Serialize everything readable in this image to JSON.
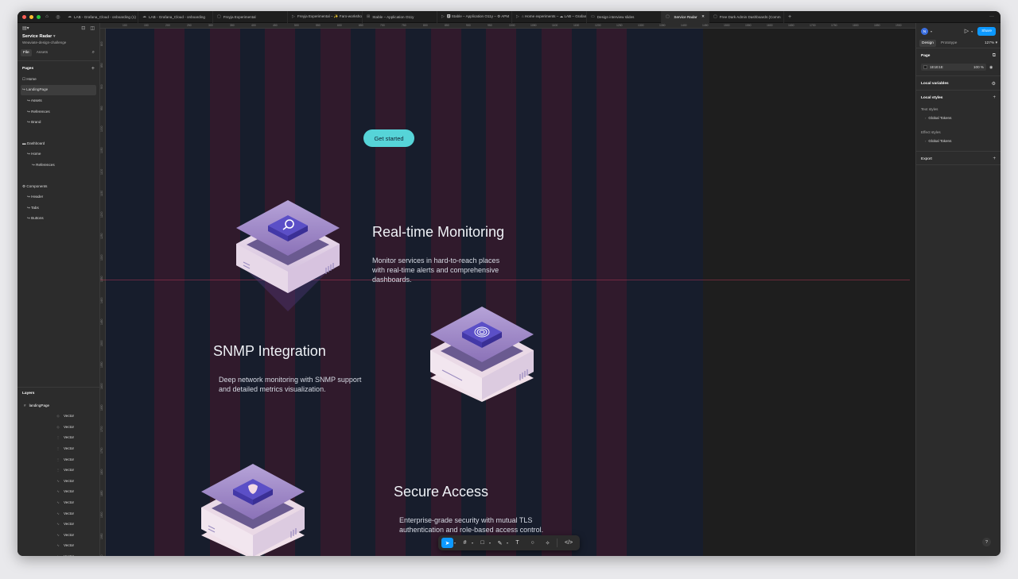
{
  "window": {
    "tabs": [
      {
        "icon": "cloud",
        "label": "LAB - Grafana_Cloud - onboarding (1)"
      },
      {
        "icon": "cloud",
        "label": "LAB - Grafana_Cloud - onboarding"
      },
      {
        "icon": "file",
        "label": "Freyja Experimental"
      },
      {
        "icon": "play",
        "label": "Freyja Experimental – ✨ Faro-workshop"
      },
      {
        "icon": "gamepad",
        "label": "Stable – Application O11y"
      },
      {
        "icon": "play",
        "label": "🅿 Stable – Application O11y – ⚙ APM"
      },
      {
        "icon": "play",
        "label": "⌂ Home experiments – ☁ LAB – Grafana"
      },
      {
        "icon": "slides",
        "label": "Design interview slides"
      },
      {
        "icon": "file",
        "label": "Service Radar",
        "active": true
      },
      {
        "icon": "file",
        "label": "Free Dark Admin Dashboards (Comm"
      }
    ]
  },
  "left_panel": {
    "project_name": "Service Radar",
    "team": "Weaviate-design-challenge",
    "file_tab": "File",
    "assets_tab": "Assets",
    "pages_heading": "Pages",
    "pages": [
      {
        "label": "☐ Home",
        "indent": 0
      },
      {
        "label": "↪ LandingPage",
        "indent": 0,
        "selected": true
      },
      {
        "label": "↪ Assets",
        "indent": 1
      },
      {
        "label": "↪ References",
        "indent": 1
      },
      {
        "label": "↪ Brand",
        "indent": 1
      },
      {
        "label": "",
        "gap": true
      },
      {
        "label": "▬ Dashboard",
        "indent": 0
      },
      {
        "label": "↪ Home",
        "indent": 1
      },
      {
        "label": "↪ References",
        "indent": 2
      },
      {
        "label": "",
        "gap": true
      },
      {
        "label": "⚙ Components",
        "indent": 0
      },
      {
        "label": "↪ Header",
        "indent": 1
      },
      {
        "label": "↪ Tabs",
        "indent": 1
      },
      {
        "label": "↪ Buttons",
        "indent": 1
      }
    ],
    "layers_heading": "Layers",
    "root_layer": "landingPage",
    "layer_items": [
      "Vector",
      "Vector",
      "Vector",
      "Vector",
      "Vector",
      "Vector",
      "Vector",
      "Vector",
      "Vector",
      "Vector",
      "Vector",
      "Vector",
      "Vector",
      "Vector"
    ]
  },
  "canvas": {
    "ruler_top": [
      "100",
      "150",
      "200",
      "250",
      "300",
      "350",
      "400",
      "450",
      "500",
      "550",
      "600",
      "650",
      "700",
      "750",
      "800",
      "850",
      "900",
      "950",
      "1000",
      "1050",
      "1100",
      "1150",
      "1200",
      "1250",
      "1300",
      "1350",
      "1400",
      "1450",
      "1500",
      "1550",
      "1600",
      "1650",
      "1700",
      "1750",
      "1800",
      "1850",
      "1900"
    ],
    "ruler_left": [
      "800",
      "850",
      "900",
      "950",
      "1000",
      "1050",
      "1100",
      "1150",
      "1200",
      "1250",
      "1300",
      "1350",
      "1400",
      "1450",
      "1500",
      "1550",
      "1600",
      "1650",
      "1700",
      "1750",
      "1800",
      "1850",
      "1900",
      "1950",
      "2000"
    ],
    "cta_label": "Get started",
    "features": [
      {
        "title": "Real-time Monitoring",
        "desc": "Monitor services in hard-to-reach places with real-time alerts and comprehensive dashboards.",
        "icon": "search-icon"
      },
      {
        "title": "SNMP Integration",
        "desc": "Deep network monitoring with SNMP support and detailed metrics visualization.",
        "icon": "fingerprint-icon"
      },
      {
        "title": "Secure Access",
        "desc": "Enterprise-grade security with mutual TLS authentication and role-based access control.",
        "icon": "shield-icon"
      }
    ],
    "colors": {
      "frame_bg": "#171d2c",
      "cta": "#56d4d8",
      "column": "#8c142d",
      "accent": "#0d99ff"
    }
  },
  "toolbar": {
    "tools": [
      "move-tool",
      "frame-tool",
      "shape-tool",
      "pen-tool",
      "text-tool",
      "comment-tool",
      "actions-tool",
      "dev-mode-toggle"
    ]
  },
  "right_panel": {
    "avatar": "N",
    "share_label": "Share",
    "design_tab": "Design",
    "prototype_tab": "Prototype",
    "zoom": "127%",
    "page_heading": "Page",
    "page_color": "1E1E1E",
    "page_opacity": "100",
    "opacity_unit": "%",
    "local_variables": "Local variables",
    "local_styles": "Local styles",
    "text_styles": "Text styles",
    "text_style_item": "Global Tokens",
    "effect_styles": "Effect styles",
    "effect_style_item": "Global Tokens",
    "export": "Export",
    "help": "?"
  }
}
